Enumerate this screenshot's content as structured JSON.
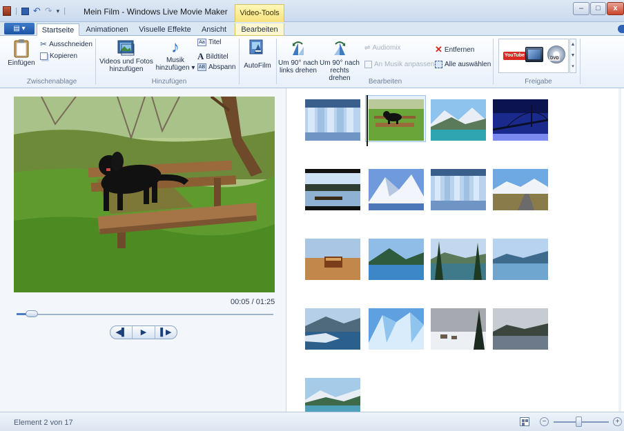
{
  "window": {
    "title": "Mein Film - Windows Live Movie Maker",
    "context_tab_group": "Video-Tools",
    "minimize": "–",
    "maximize": "□",
    "close": "x"
  },
  "quick_access": {
    "save_icon": "save-icon",
    "undo_icon": "undo-icon",
    "redo_icon": "redo-icon",
    "separator": "|"
  },
  "tabs": {
    "app_menu": "▤ ▾",
    "items": [
      "Startseite",
      "Animationen",
      "Visuelle Effekte",
      "Ansicht",
      "Bearbeiten"
    ],
    "active": "Startseite"
  },
  "ribbon": {
    "zwischenablage": {
      "label": "Zwischenablage",
      "einfuegen": "Einfügen",
      "ausschneiden": "Ausschneiden",
      "kopieren": "Kopieren"
    },
    "hinzufuegen": {
      "label": "Hinzufügen",
      "videos_line1": "Videos und Fotos",
      "videos_line2": "hinzufügen",
      "musik_line1": "Musik",
      "musik_line2": "hinzufügen ▾",
      "titel": "Titel",
      "bildtitel": "Bildtitel",
      "abspann": "Abspann"
    },
    "autofilm": {
      "label": "AutoFilm"
    },
    "bearbeiten": {
      "label": "Bearbeiten",
      "rotate_left_line1": "Um 90° nach",
      "rotate_left_line2": "links drehen",
      "rotate_right_line1": "Um 90° nach",
      "rotate_right_line2": "rechts drehen",
      "audiomix": "Audiomix",
      "an_musik": "An Musik anpassen",
      "entfernen": "Entfernen",
      "alle_auswaehlen": "Alle auswählen"
    },
    "freigabe": {
      "label": "Freigabe",
      "youtube": "YouTube",
      "dvd": "DVD"
    }
  },
  "preview": {
    "time": "00:05 / 01:25",
    "progress_fraction": 0.06,
    "prev_frame": "◀▌",
    "play": "▶",
    "next_frame": "▌▶"
  },
  "storyboard": {
    "selected_index": 1,
    "clips": [
      "glass-building",
      "black-dog-on-bench",
      "mountain-lake",
      "bridge-night",
      "dock-on-lake",
      "snowy-peak",
      "glass-building-2",
      "mountain-road",
      "wooden-sign",
      "fjord",
      "forest-lake",
      "blue-lake",
      "glacier-shore",
      "glacier-ice",
      "snow-village",
      "misty-lake",
      "teal-lake"
    ]
  },
  "status": {
    "text": "Element 2 von 17",
    "zoom_level": 0.45,
    "zoom_out": "−",
    "zoom_in": "+"
  },
  "colors": {
    "accent": "#2c63b8",
    "context_tab": "#f5e27a",
    "ribbon_bg": "#e8f0fa",
    "selection": "#9fc3ec"
  }
}
